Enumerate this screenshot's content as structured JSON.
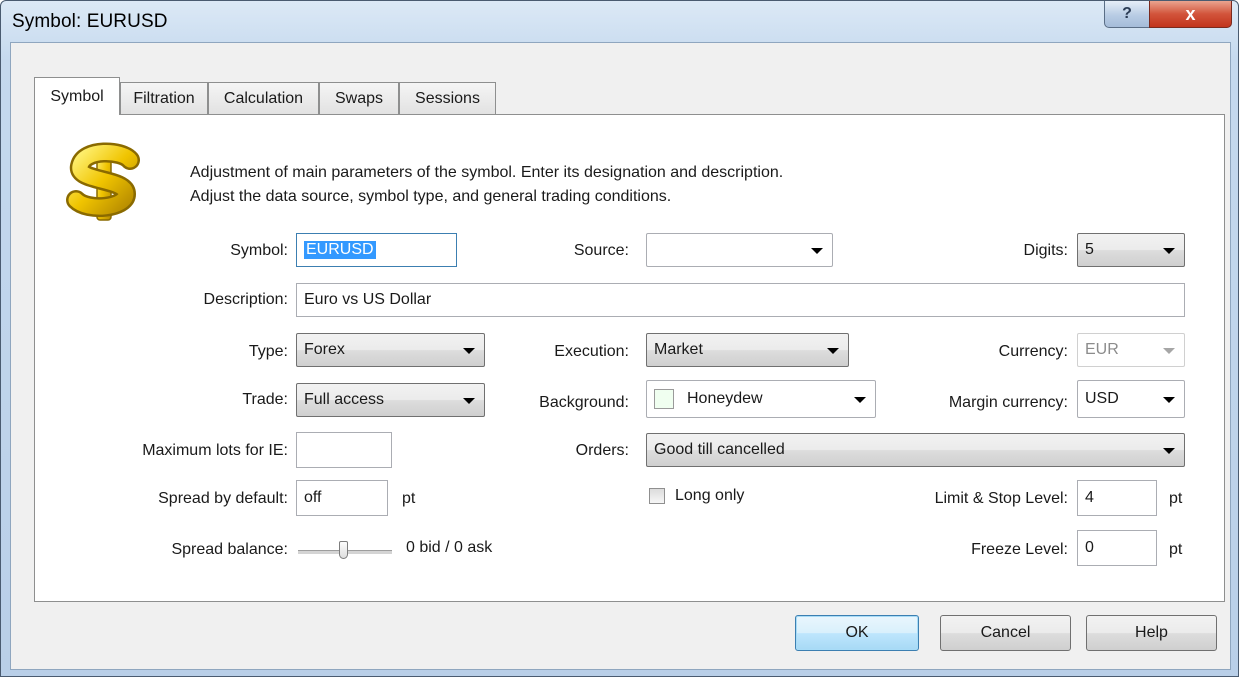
{
  "window": {
    "title": "Symbol: EURUSD",
    "help_glyph": "?",
    "close_glyph": "x"
  },
  "tabs": [
    {
      "label": "Symbol",
      "active": true
    },
    {
      "label": "Filtration",
      "active": false
    },
    {
      "label": "Calculation",
      "active": false
    },
    {
      "label": "Swaps",
      "active": false
    },
    {
      "label": "Sessions",
      "active": false
    }
  ],
  "intro": {
    "icon": "dollar-sign-icon",
    "line1": "Adjustment of main parameters of the symbol. Enter its designation and description.",
    "line2": "Adjust the data source, symbol type, and general trading conditions."
  },
  "fields": {
    "symbol": {
      "label": "Symbol:",
      "value": "EURUSD"
    },
    "source": {
      "label": "Source:",
      "value": ""
    },
    "digits": {
      "label": "Digits:",
      "value": "5"
    },
    "description": {
      "label": "Description:",
      "value": "Euro vs US Dollar"
    },
    "type": {
      "label": "Type:",
      "value": "Forex"
    },
    "execution": {
      "label": "Execution:",
      "value": "Market"
    },
    "currency": {
      "label": "Currency:",
      "value": "EUR"
    },
    "trade": {
      "label": "Trade:",
      "value": "Full access"
    },
    "background": {
      "label": "Background:",
      "value": "Honeydew",
      "swatch_color": "#f0fff0"
    },
    "margin_currency": {
      "label": "Margin currency:",
      "value": "USD"
    },
    "max_lots_ie": {
      "label": "Maximum lots for IE:",
      "value": ""
    },
    "orders": {
      "label": "Orders:",
      "value": "Good till cancelled"
    },
    "spread_default": {
      "label": "Spread by default:",
      "value": "off",
      "unit": "pt"
    },
    "long_only": {
      "label": "Long only",
      "checked": false
    },
    "limit_stop_level": {
      "label": "Limit & Stop Level:",
      "value": "4",
      "unit": "pt"
    },
    "spread_balance": {
      "label": "Spread balance:",
      "readout": "0 bid / 0 ask",
      "position": 0.5
    },
    "freeze_level": {
      "label": "Freeze Level:",
      "value": "0",
      "unit": "pt"
    }
  },
  "buttons": {
    "ok": "OK",
    "cancel": "Cancel",
    "help": "Help"
  }
}
